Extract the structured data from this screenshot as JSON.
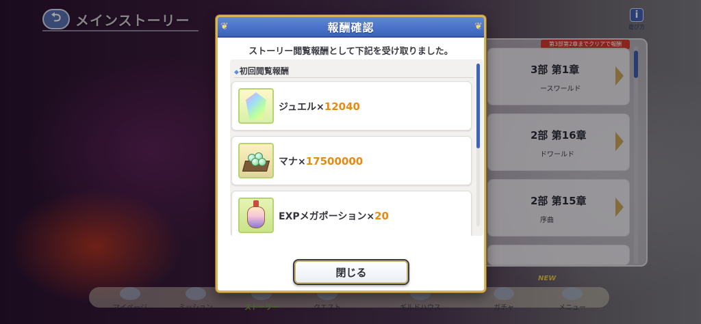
{
  "header": {
    "back_icon": "back-arrow-icon",
    "title": "メインストーリー",
    "info_icon_text": "i",
    "info_label": "遊び方"
  },
  "chapters": {
    "badge": "第3部第2章までクリアで報酬",
    "items": [
      {
        "title": "3部 第1章",
        "subtitle": "ースワールド"
      },
      {
        "title": "2部 第16章",
        "subtitle": "ドワールド"
      },
      {
        "title": "2部 第15章",
        "subtitle": "序曲"
      },
      {
        "title": "",
        "subtitle": ""
      }
    ]
  },
  "bottom_nav": {
    "items": [
      {
        "label": "マイページ",
        "icon": "castle-icon",
        "active": false
      },
      {
        "label": "ミッション",
        "icon": "character-icon",
        "active": false
      },
      {
        "label": "ストーリー",
        "icon": "book-icon",
        "active": true
      },
      {
        "label": "クエスト",
        "icon": "sword-icon",
        "active": false
      },
      {
        "label": "ギルドハウス",
        "icon": "house-icon",
        "active": false
      },
      {
        "label": "ガチャ",
        "icon": "gacha-icon",
        "active": false
      },
      {
        "label": "メニュー",
        "icon": "menu-icon",
        "active": false
      }
    ],
    "new_badge": "NEW"
  },
  "modal": {
    "title": "報酬確認",
    "message": "ストーリー閲覧報酬として下記を受け取りました。",
    "section_label": "初回閲覧報酬",
    "rewards": [
      {
        "name": "ジュエル×",
        "quantity": "12040",
        "icon": "jewel-icon"
      },
      {
        "name": "マナ×",
        "quantity": "17500000",
        "icon": "mana-icon"
      },
      {
        "name": "EXPメガポーション×",
        "quantity": "20",
        "icon": "exp-potion-icon"
      }
    ],
    "close_label": "閉じる"
  }
}
